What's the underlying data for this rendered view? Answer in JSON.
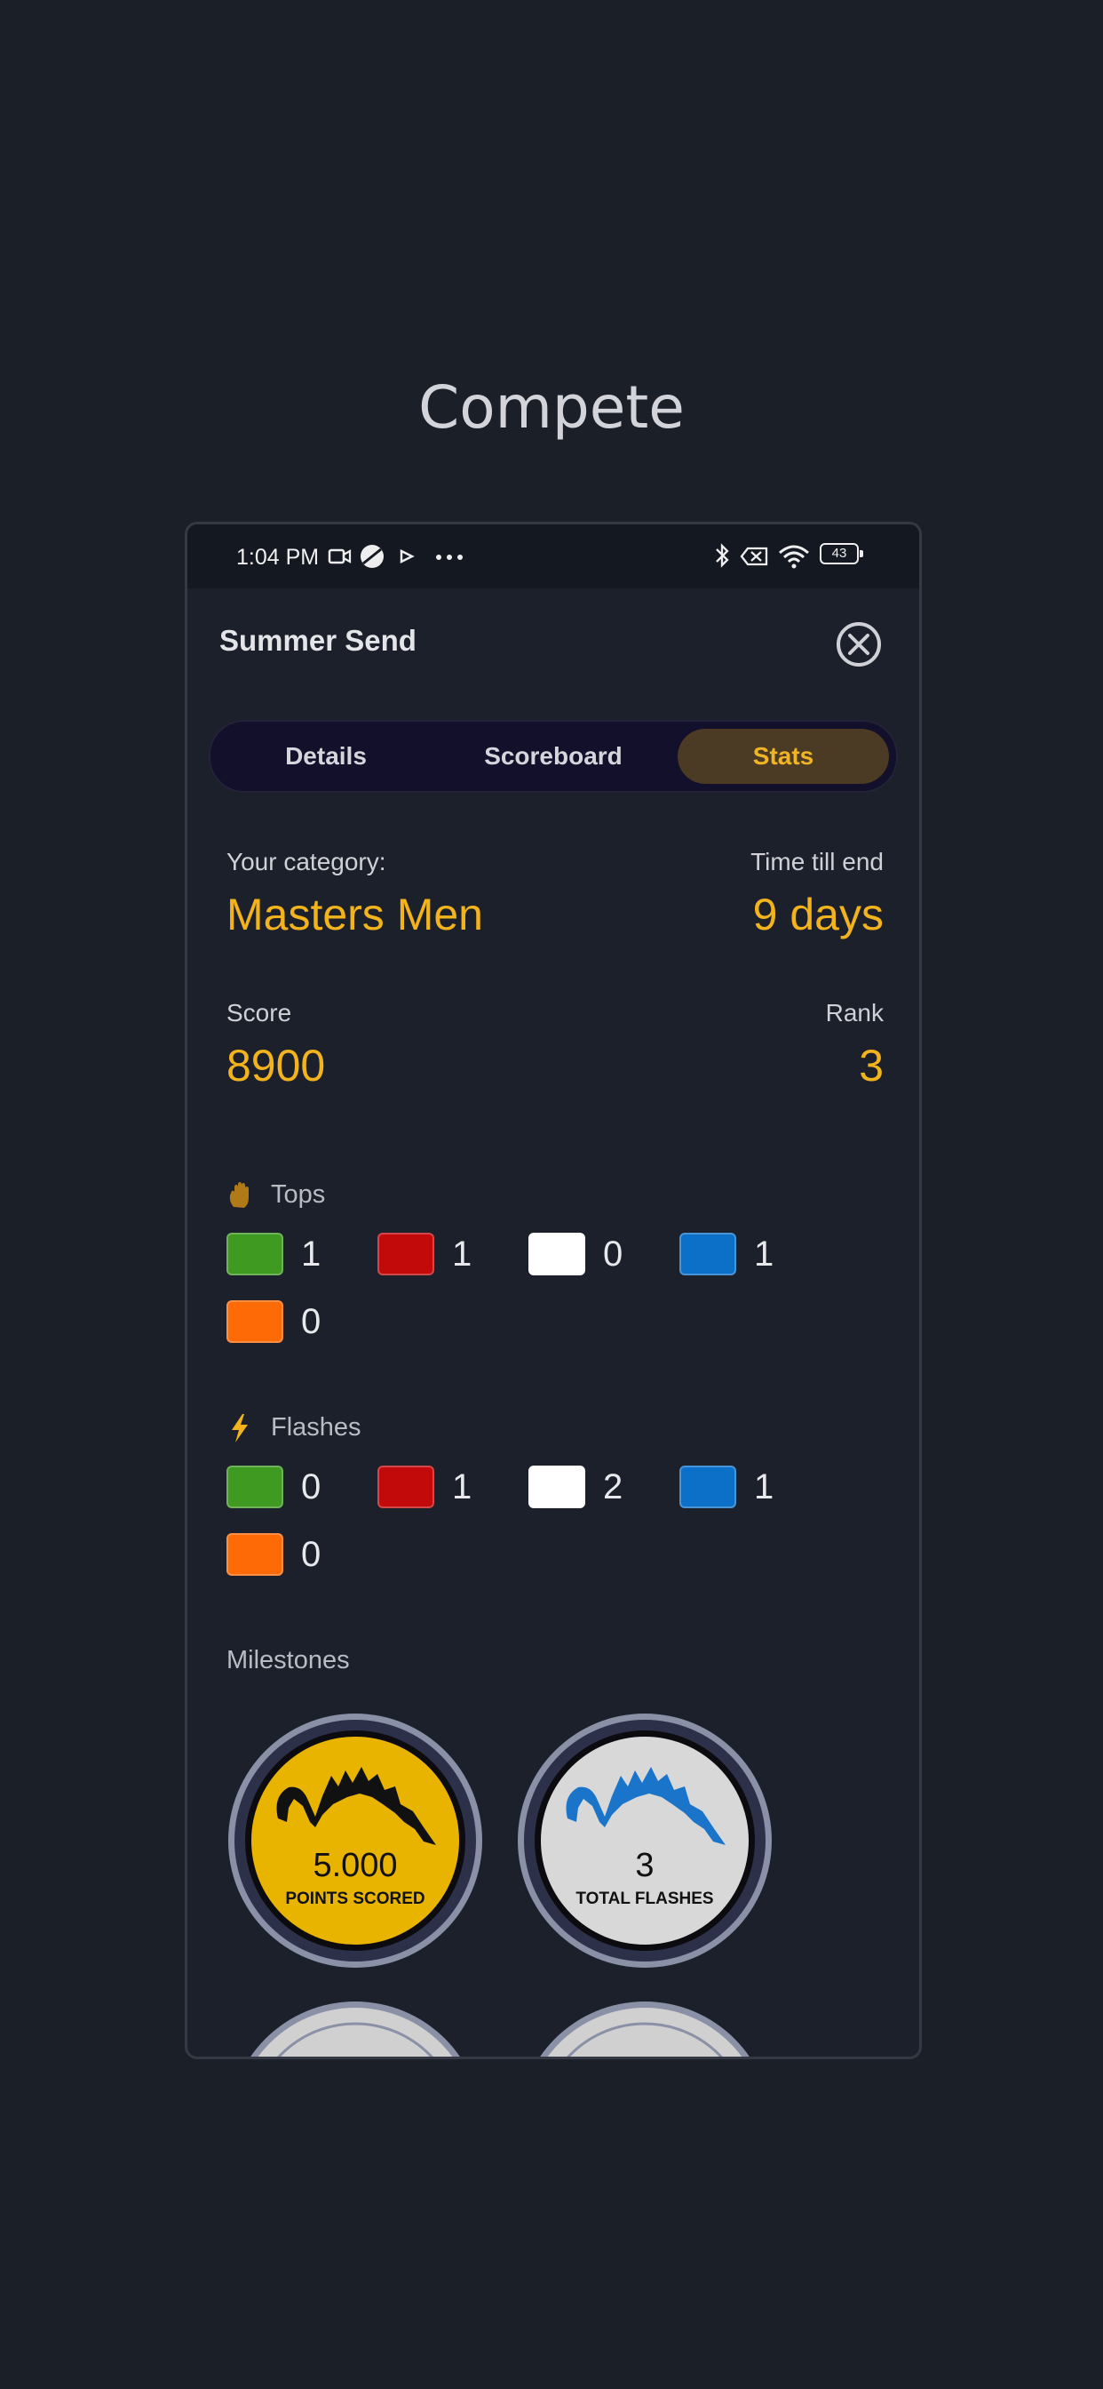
{
  "page": {
    "heading": "Compete"
  },
  "status_bar": {
    "time": "1:04 PM",
    "battery": "43"
  },
  "header": {
    "title": "Summer Send"
  },
  "tabs": [
    {
      "label": "Details",
      "active": false
    },
    {
      "label": "Scoreboard",
      "active": false
    },
    {
      "label": "Stats",
      "active": true
    }
  ],
  "stats": {
    "category_label": "Your category:",
    "category_value": "Masters Men",
    "time_label": "Time till end",
    "time_value": "9 days",
    "score_label": "Score",
    "score_value": "8900",
    "rank_label": "Rank",
    "rank_value": "3"
  },
  "tops": {
    "title": "Tops",
    "items": [
      {
        "color": "#3f9a22",
        "count": "1"
      },
      {
        "color": "#c30a0a",
        "count": "1"
      },
      {
        "color": "#ffffff",
        "count": "0"
      },
      {
        "color": "#0d70c8",
        "count": "1"
      },
      {
        "color": "#fd6a06",
        "count": "0"
      }
    ]
  },
  "flashes": {
    "title": "Flashes",
    "items": [
      {
        "color": "#3f9a22",
        "count": "0"
      },
      {
        "color": "#c30a0a",
        "count": "1"
      },
      {
        "color": "#ffffff",
        "count": "2"
      },
      {
        "color": "#0d70c8",
        "count": "1"
      },
      {
        "color": "#fd6a06",
        "count": "0"
      }
    ]
  },
  "milestones": {
    "title": "Milestones",
    "badges": [
      {
        "value": "5.000",
        "caption": "POINTS SCORED",
        "fill": "#e8b400",
        "mountain": "#111111"
      },
      {
        "value": "3",
        "caption": "TOTAL FLASHES",
        "fill": "#d8d8d8",
        "mountain": "#1a74c9"
      }
    ]
  },
  "colors": {
    "accent": "#f2b31d",
    "background": "#1b1f28"
  }
}
